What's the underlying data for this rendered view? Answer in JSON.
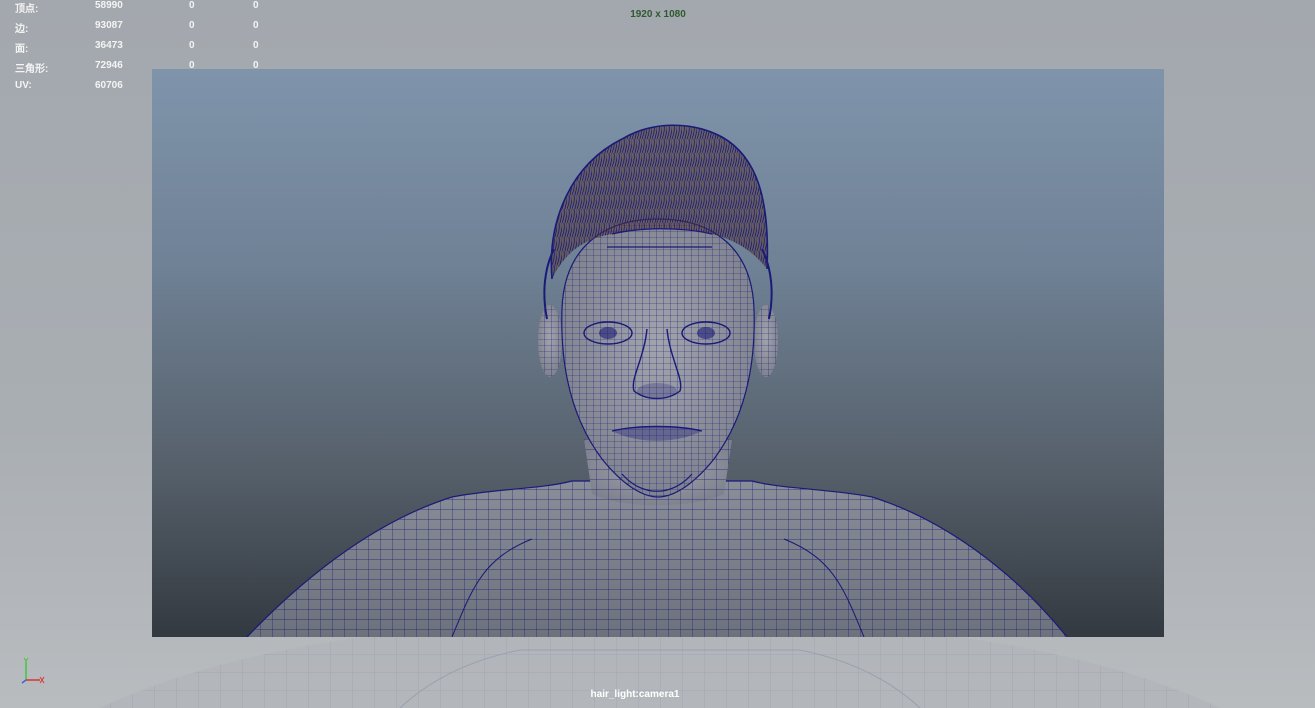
{
  "hud": {
    "rows": [
      {
        "label": "顶点:",
        "total": "58990",
        "selected": "0",
        "selected2": "0"
      },
      {
        "label": "边:",
        "total": "93087",
        "selected": "0",
        "selected2": "0"
      },
      {
        "label": "面:",
        "total": "36473",
        "selected": "0",
        "selected2": "0"
      },
      {
        "label": "三角形:",
        "total": "72946",
        "selected": "0",
        "selected2": "0"
      },
      {
        "label": "UV:",
        "total": "60706",
        "selected": "0",
        "selected2": "0"
      }
    ]
  },
  "resolution_gate": "1920 x 1080",
  "camera_name": "hair_light:camera1",
  "wireframe_color": "#1a1a78",
  "hair_color": "#5a3a32",
  "axis": {
    "y_color": "#3cc83c",
    "x_color": "#dc3232",
    "z_color": "#3c64dc"
  }
}
